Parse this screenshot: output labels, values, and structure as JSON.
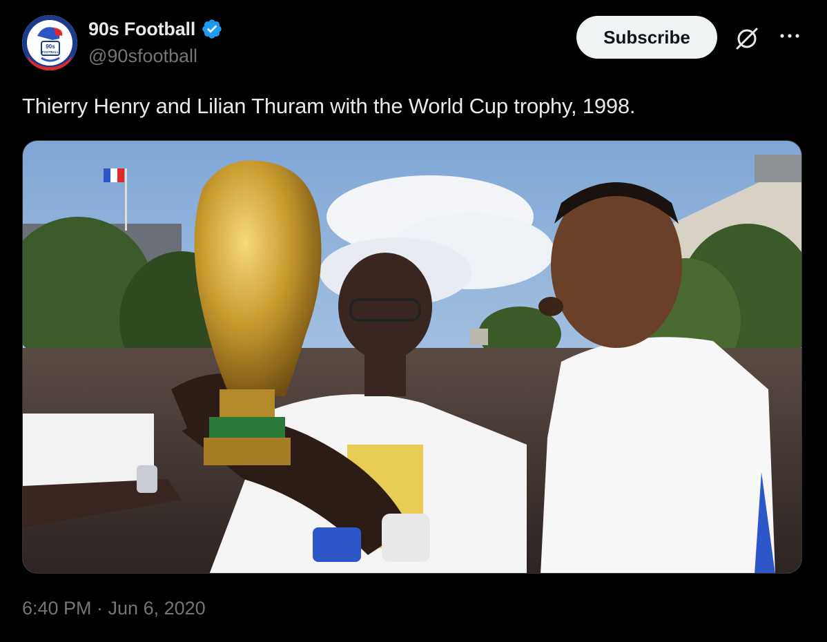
{
  "author": {
    "display_name": "90s Football",
    "handle": "@90sfootball",
    "verified": true,
    "avatar_icon": "mascot-logo-icon",
    "avatar_text": "90s FOOTBALL"
  },
  "actions": {
    "subscribe_label": "Subscribe",
    "grok_icon": "grok-icon",
    "more_icon": "more-options-icon"
  },
  "tweet": {
    "text": "Thierry Henry and Lilian Thuram with the World Cup trophy, 1998.",
    "timestamp": "6:40 PM · Jun 6, 2020"
  },
  "colors": {
    "background": "#000000",
    "primary_text": "#e7e9ea",
    "secondary_text": "#71767b",
    "verified_blue": "#1d9bf0",
    "button_bg": "#eff3f4"
  }
}
